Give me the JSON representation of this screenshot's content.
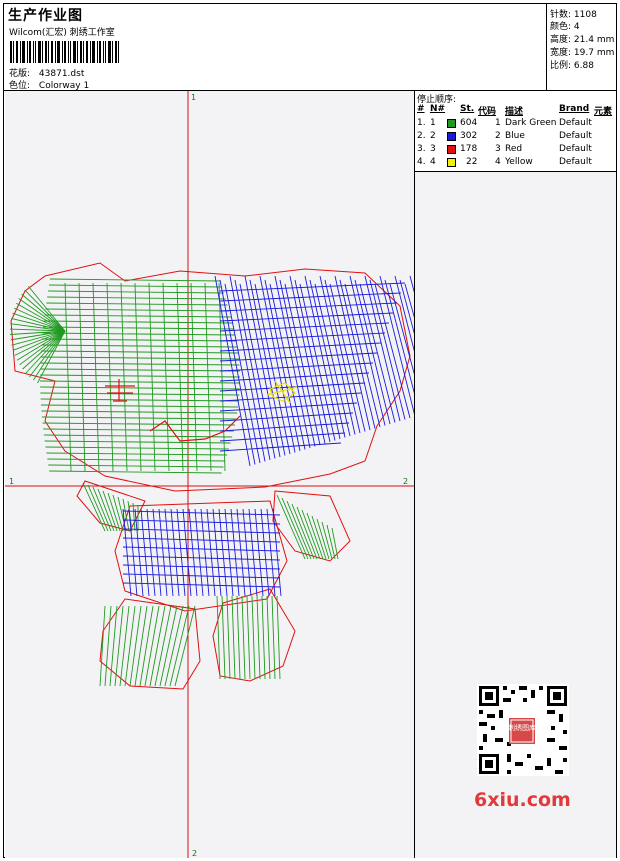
{
  "header": {
    "title": "生产作业图",
    "company": "Wilcom(汇宏) 刺绣工作室",
    "design_label": "花版:",
    "design_value": "43871.dst",
    "colorway_label": "色位:",
    "colorway_value": "Colorway 1"
  },
  "stats": [
    {
      "label": "针数:",
      "value": "1108"
    },
    {
      "label": "颜色:",
      "value": "4"
    },
    {
      "label": "高度:",
      "value": "21.4 mm"
    },
    {
      "label": "宽度:",
      "value": "19.7 mm"
    },
    {
      "label": "比例:",
      "value": "6.88"
    }
  ],
  "stop_sequence": {
    "title": "停止顺序:",
    "headers": {
      "num": "#",
      "no": "N#",
      "stitches": "St.",
      "code": "代码",
      "desc": "描述",
      "brand": "Brand",
      "elem": "元素"
    },
    "rows": [
      {
        "num": "1.",
        "no": "1",
        "stitches": "604",
        "code": "1",
        "desc": "Dark Green",
        "brand": "Default",
        "color": "#1f9a1f"
      },
      {
        "num": "2.",
        "no": "2",
        "stitches": "302",
        "code": "2",
        "desc": "Blue",
        "brand": "Default",
        "color": "#1a1adc"
      },
      {
        "num": "3.",
        "no": "3",
        "stitches": "178",
        "code": "3",
        "desc": "Red",
        "brand": "Default",
        "color": "#e01010"
      },
      {
        "num": "4.",
        "no": "4",
        "stitches": "22",
        "code": "4",
        "desc": "Yellow",
        "brand": "Default",
        "color": "#f0f000"
      }
    ]
  },
  "axes": {
    "top": "1",
    "bottom": "2",
    "left": "1",
    "right": "2"
  },
  "watermark": {
    "text": "6xiu.com",
    "badge": "刺绣图库"
  },
  "colors": {
    "green": "#1f9a1f",
    "blue": "#1a1adc",
    "red": "#e01010",
    "yellow": "#f0e000",
    "axis": "#d01010"
  }
}
